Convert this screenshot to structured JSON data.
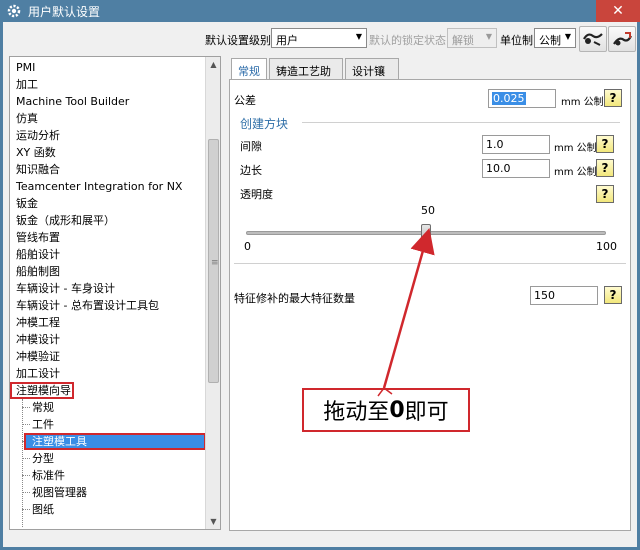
{
  "window": {
    "title": "用户默认设置",
    "close_glyph": "✕"
  },
  "toolbar": {
    "level_label": "默认设置级别",
    "level_value": "用户",
    "lock_label": "默认的锁定状态",
    "lock_value": "解锁",
    "units_label": "单位制",
    "units_value": "公制"
  },
  "tree": {
    "items": [
      "PMI",
      "加工",
      "Machine Tool Builder",
      "仿真",
      "运动分析",
      "XY 函数",
      "知识融合",
      "Teamcenter Integration for NX",
      "钣金",
      "钣金（成形和展平）",
      "管线布置",
      "船舶设计",
      "船舶制图",
      "车辆设计 - 车身设计",
      "车辆设计 - 总布置设计工具包",
      "冲模工程",
      "冲模设计",
      "冲模验证",
      "加工设计",
      "注塑模向导"
    ],
    "subitems": [
      "常规",
      "工件",
      "注塑模工具",
      "分型",
      "标准件",
      "视图管理器",
      "图纸"
    ],
    "selected_sub_index": 2
  },
  "tabs": [
    {
      "label": "常规"
    },
    {
      "label": "铸造工艺助理"
    },
    {
      "label": "设计镶块"
    }
  ],
  "panel": {
    "tolerance_label": "公差",
    "tolerance_value": "0.025",
    "tolerance_unit": "mm 公制",
    "group_title": "创建方块",
    "gap_label": "间隙",
    "gap_value": "1.0",
    "gap_unit": "mm 公制",
    "edge_label": "边长",
    "edge_value": "10.0",
    "edge_unit": "mm 公制",
    "transparency_label": "透明度",
    "slider_value": "50",
    "slider_min": "0",
    "slider_max": "100",
    "slider_fraction": 0.5,
    "max_feature_label": "特征修补的最大特征数量",
    "max_feature_value": "150",
    "help_glyph": "?"
  },
  "annotation": {
    "text_prefix": "拖动至",
    "text_bold": "0",
    "text_suffix": "即可"
  },
  "colors": {
    "title_bar": "#4f7fa3",
    "selection": "#3a8ee6",
    "annotation_red": "#d0282d"
  }
}
